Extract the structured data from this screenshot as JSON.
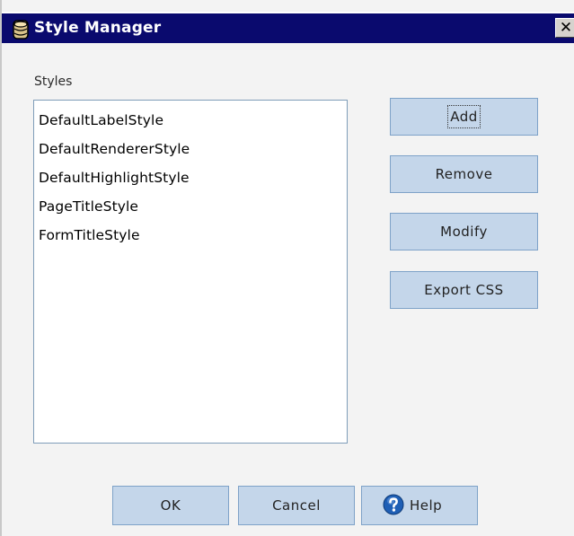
{
  "window": {
    "title": "Style Manager",
    "close_glyph": "✕"
  },
  "styles": {
    "label": "Styles",
    "items": [
      "DefaultLabelStyle",
      "DefaultRendererStyle",
      "DefaultHighlightStyle",
      "PageTitleStyle",
      "FormTitleStyle"
    ]
  },
  "actions": {
    "add": "Add",
    "remove": "Remove",
    "modify": "Modify",
    "export_css": "Export CSS"
  },
  "footer": {
    "ok": "OK",
    "cancel": "Cancel",
    "help": "Help"
  },
  "icons": {
    "title": "database-icon",
    "help": "help-icon"
  },
  "colors": {
    "titlebar": "#0a0a6e",
    "button_fill": "#c4d6ea",
    "button_border": "#7ea2c8",
    "help_icon": "#1f5fb5"
  }
}
